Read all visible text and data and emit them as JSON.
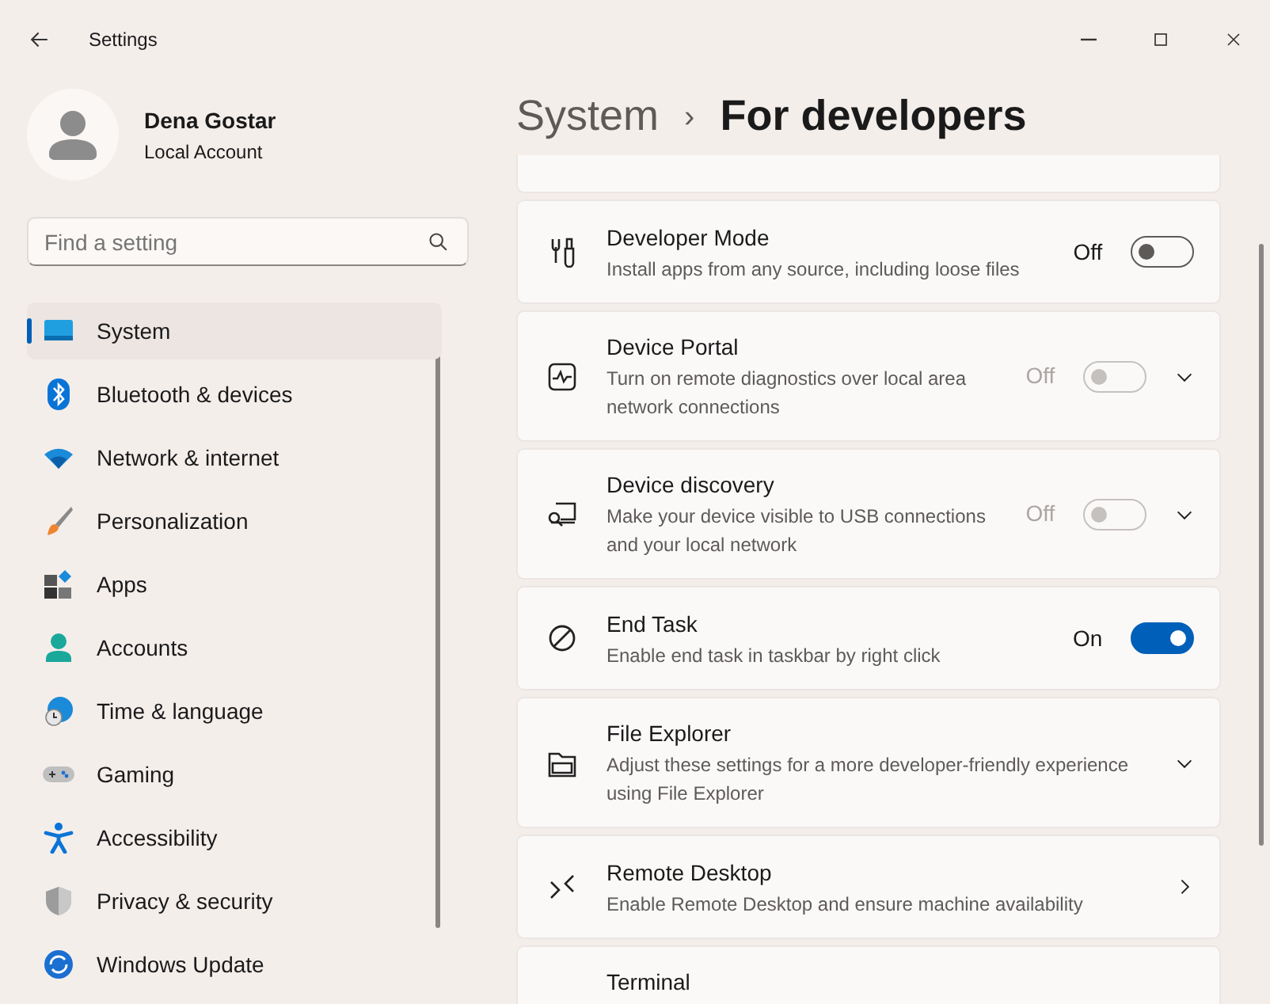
{
  "window": {
    "title": "Settings"
  },
  "profile": {
    "name": "Dena Gostar",
    "account": "Local Account"
  },
  "search": {
    "placeholder": "Find a setting"
  },
  "sidebar": {
    "items": [
      {
        "label": "System",
        "selected": true
      },
      {
        "label": "Bluetooth & devices",
        "selected": false
      },
      {
        "label": "Network & internet",
        "selected": false
      },
      {
        "label": "Personalization",
        "selected": false
      },
      {
        "label": "Apps",
        "selected": false
      },
      {
        "label": "Accounts",
        "selected": false
      },
      {
        "label": "Time & language",
        "selected": false
      },
      {
        "label": "Gaming",
        "selected": false
      },
      {
        "label": "Accessibility",
        "selected": false
      },
      {
        "label": "Privacy & security",
        "selected": false
      },
      {
        "label": "Windows Update",
        "selected": false
      }
    ]
  },
  "breadcrumb": {
    "parent": "System",
    "separator": "›",
    "current": "For developers"
  },
  "settings": [
    {
      "kind": "toggle",
      "title": "Developer Mode",
      "description": "Install apps from any source, including loose files",
      "state_label": "Off",
      "on": false,
      "disabled": false
    },
    {
      "kind": "toggle-expander",
      "title": "Device Portal",
      "description": "Turn on remote diagnostics over local area network connections",
      "state_label": "Off",
      "on": false,
      "disabled": true
    },
    {
      "kind": "toggle-expander",
      "title": "Device discovery",
      "description": "Make your device visible to USB connections and your local network",
      "state_label": "Off",
      "on": false,
      "disabled": true
    },
    {
      "kind": "toggle",
      "title": "End Task",
      "description": "Enable end task in taskbar by right click",
      "state_label": "On",
      "on": true,
      "disabled": false
    },
    {
      "kind": "expander",
      "title": "File Explorer",
      "description": "Adjust these settings for a more developer-friendly experience using File Explorer"
    },
    {
      "kind": "link",
      "title": "Remote Desktop",
      "description": "Enable Remote Desktop and ensure machine availability"
    },
    {
      "kind": "plain",
      "title": "Terminal"
    }
  ]
}
